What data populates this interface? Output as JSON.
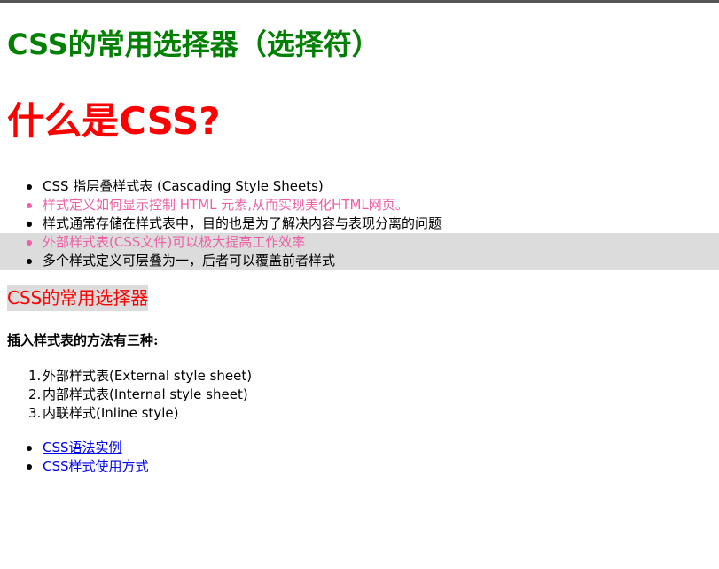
{
  "page": {
    "title": "CSS的常用选择器（选择符）",
    "heading": "什么是CSS?",
    "features": [
      "CSS 指层叠样式表 (Cascading Style Sheets)",
      "样式定义如何显示控制 HTML 元素,从而实现美化HTML网页。",
      "样式通常存储在样式表中，目的也是为了解决内容与表现分离的问题",
      "外部样式表(CSS文件)可以极大提高工作效率",
      "多个样式定义可层叠为一，后者可以覆盖前者样式"
    ],
    "subheading": "CSS的常用选择器",
    "methods_label": "插入样式表的方法有三种:",
    "styles": [
      {
        "num": "1.",
        "text": "外部样式表(External style sheet)"
      },
      {
        "num": "2.",
        "text": "内部样式表(Internal style sheet)"
      },
      {
        "num": "3.",
        "text": "内联样式(Inline style)"
      }
    ],
    "links": [
      "CSS语法实例",
      "CSS样式使用方式"
    ]
  },
  "colors": {
    "title": "#008000",
    "heading": "#ff0000",
    "pink_text": "#ee5fa6",
    "highlight_bg": "#dcdcdc",
    "link": "#0000ee"
  }
}
